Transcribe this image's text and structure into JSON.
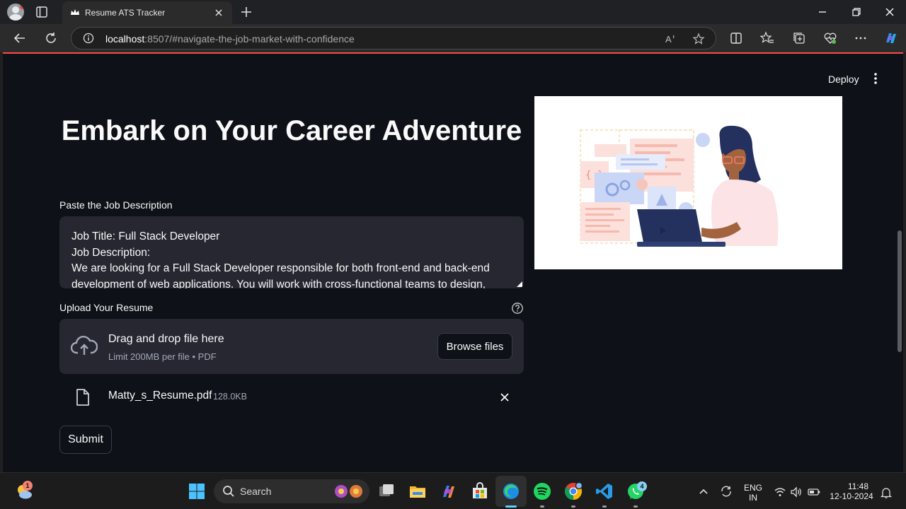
{
  "browser": {
    "tab_title": "Resume ATS Tracker",
    "url_host": "localhost",
    "url_rest": ":8507/#navigate-the-job-market-with-confidence"
  },
  "app": {
    "deploy_label": "Deploy",
    "title": "Embark on Your Career Adventure",
    "jd_label": "Paste the Job Description",
    "jd_text": "Job Title: Full Stack Developer\nJob Description:\nWe are looking for a Full Stack Developer responsible for both front-end and back-end development of web applications. You will work with cross-functional teams to design, build,",
    "upload_label": "Upload Your Resume",
    "dropzone_title": "Drag and drop file here",
    "dropzone_subtitle": "Limit 200MB per file • PDF",
    "browse_label": "Browse files",
    "file": {
      "name": "Matty_s_Resume.pdf",
      "size": "128.0KB"
    },
    "submit_label": "Submit",
    "accent": "#ff4b4b"
  },
  "taskbar": {
    "search_placeholder": "Search",
    "weather_badge": "1",
    "whatsapp_badge": "4",
    "lang_top": "ENG",
    "lang_bottom": "IN",
    "time": "11:48",
    "date": "12-10-2024",
    "icons": [
      "windows-start",
      "task-view",
      "file-explorer",
      "copilot",
      "microsoft-store",
      "edge",
      "spotify",
      "chrome",
      "vscode",
      "whatsapp"
    ]
  }
}
